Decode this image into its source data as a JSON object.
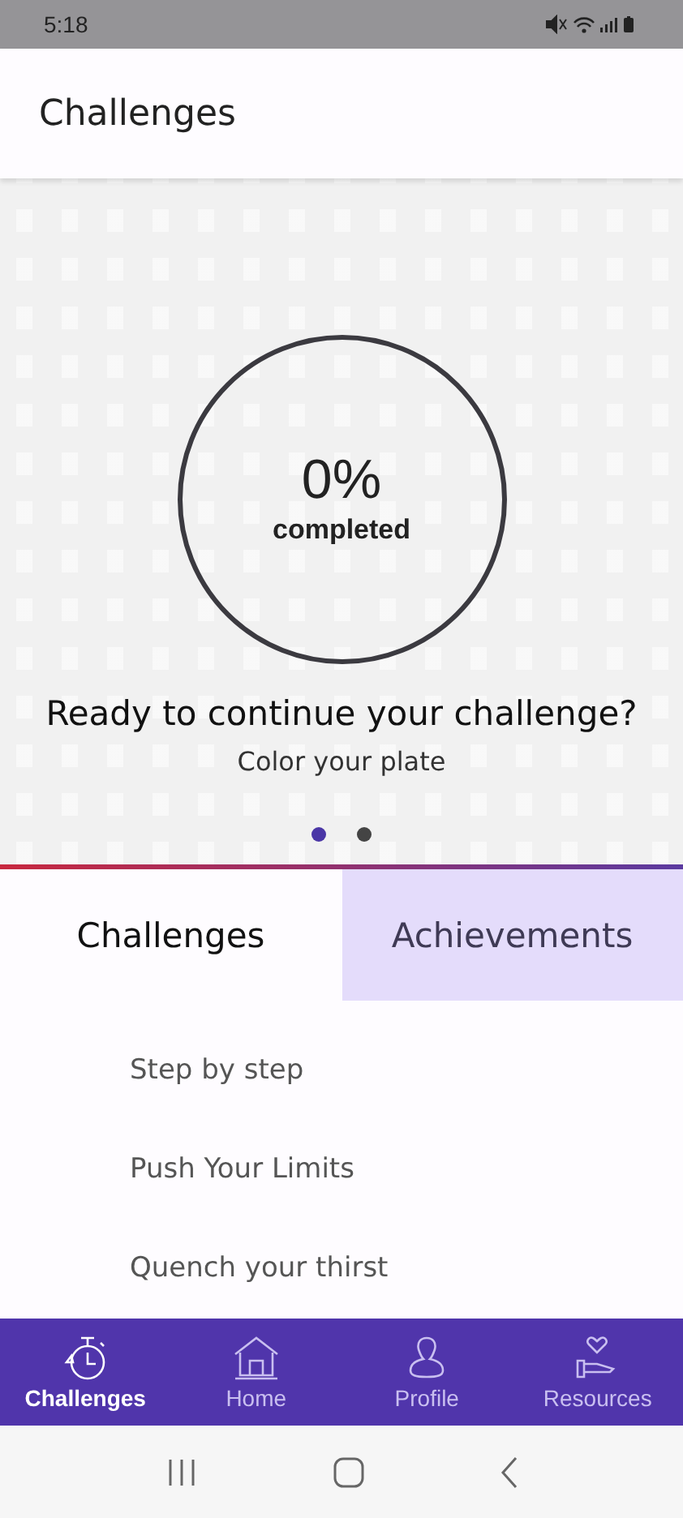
{
  "status_bar": {
    "time": "5:18"
  },
  "header": {
    "title": "Challenges"
  },
  "progress": {
    "percent": "0%",
    "caption": "completed",
    "level": 0
  },
  "hero": {
    "title": "Ready to continue your challenge?",
    "subtitle": "Color your plate"
  },
  "pager": [
    {
      "selected": true
    },
    {
      "selected": false
    }
  ],
  "tabs": [
    {
      "label": "Challenges",
      "selected": true
    },
    {
      "label": "Achievements",
      "selected": false
    }
  ],
  "challenges": [
    "Step by step",
    "Push Your Limits",
    "Quench your thirst"
  ],
  "bottom_nav": [
    {
      "label": "Challenges",
      "kind": "stopwatch",
      "selected": true
    },
    {
      "label": "Home",
      "kind": "home",
      "selected": false
    },
    {
      "label": "Profile",
      "kind": "person",
      "selected": false
    },
    {
      "label": "Resources",
      "kind": "hand-heart",
      "selected": false
    }
  ]
}
